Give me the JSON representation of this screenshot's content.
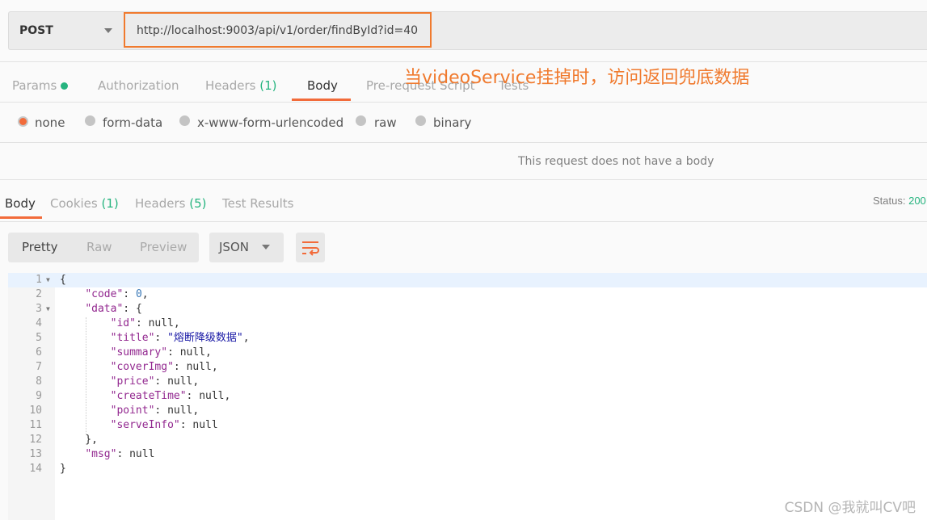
{
  "request": {
    "method": "POST",
    "url": "http://localhost:9003/api/v1/order/findById?id=40"
  },
  "annotation": "当videoService挂掉时，访问返回兜底数据",
  "request_tabs": [
    {
      "label": "Params"
    },
    {
      "label": "Authorization"
    },
    {
      "label": "Headers",
      "count": "(1)"
    },
    {
      "label": "Body"
    },
    {
      "label": "Pre-request Script"
    },
    {
      "label": "Tests"
    }
  ],
  "body_types": [
    {
      "label": "none",
      "selected": true
    },
    {
      "label": "form-data"
    },
    {
      "label": "x-www-form-urlencoded"
    },
    {
      "label": "raw"
    },
    {
      "label": "binary"
    }
  ],
  "no_body_text": "This request does not have a body",
  "response_tabs": [
    {
      "label": "Body"
    },
    {
      "label": "Cookies",
      "count": "(1)"
    },
    {
      "label": "Headers",
      "count": "(5)"
    },
    {
      "label": "Test Results"
    }
  ],
  "status": {
    "label": "Status:",
    "value": "200"
  },
  "view_modes": [
    "Pretty",
    "Raw",
    "Preview"
  ],
  "format": "JSON",
  "colors": {
    "accent": "#f26b3a",
    "green": "#26b47f"
  },
  "lines": [
    {
      "n": "1",
      "t": "{"
    },
    {
      "n": "2",
      "k": "\"code\"",
      "v": "0",
      "vt": "n",
      "e": ","
    },
    {
      "n": "3",
      "k": "\"data\"",
      "v": "{",
      "vt": "p",
      "e": ""
    },
    {
      "n": "4",
      "k": "\"id\"",
      "v": "null",
      "vt": "p",
      "e": ","
    },
    {
      "n": "5",
      "k": "\"title\"",
      "v": "\"熔断降级数据\"",
      "vt": "s",
      "e": ","
    },
    {
      "n": "6",
      "k": "\"summary\"",
      "v": "null",
      "vt": "p",
      "e": ","
    },
    {
      "n": "7",
      "k": "\"coverImg\"",
      "v": "null",
      "vt": "p",
      "e": ","
    },
    {
      "n": "8",
      "k": "\"price\"",
      "v": "null",
      "vt": "p",
      "e": ","
    },
    {
      "n": "9",
      "k": "\"createTime\"",
      "v": "null",
      "vt": "p",
      "e": ","
    },
    {
      "n": "10",
      "k": "\"point\"",
      "v": "null",
      "vt": "p",
      "e": ","
    },
    {
      "n": "11",
      "k": "\"serveInfo\"",
      "v": "null",
      "vt": "p",
      "e": ""
    },
    {
      "n": "12",
      "t": "    },"
    },
    {
      "n": "13",
      "k": "\"msg\"",
      "v": "null",
      "vt": "p",
      "e": ""
    },
    {
      "n": "14",
      "t": "}"
    }
  ],
  "watermark": "CSDN @我就叫CV吧"
}
